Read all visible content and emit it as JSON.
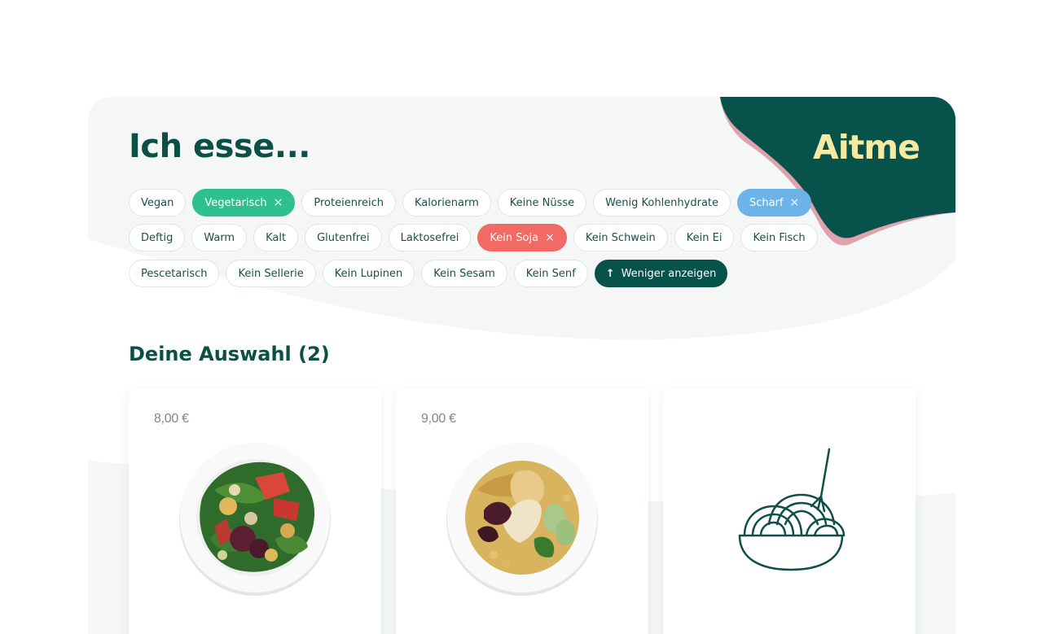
{
  "brand": {
    "logo_text": "Aitme"
  },
  "header": {
    "title": "Ich esse..."
  },
  "filters": {
    "row1": [
      {
        "label": "Vegan",
        "state": "off"
      },
      {
        "label": "Vegetarisch",
        "state": "green"
      },
      {
        "label": "Proteienreich",
        "state": "off"
      },
      {
        "label": "Kalorienarm",
        "state": "off"
      },
      {
        "label": "Keine Nüsse",
        "state": "off"
      },
      {
        "label": "Wenig Kohlenhydrate",
        "state": "off"
      },
      {
        "label": "Scharf",
        "state": "blue"
      }
    ],
    "row2": [
      {
        "label": "Deftig",
        "state": "off"
      },
      {
        "label": "Warm",
        "state": "off"
      },
      {
        "label": "Kalt",
        "state": "off"
      },
      {
        "label": "Glutenfrei",
        "state": "off"
      },
      {
        "label": "Laktosefrei",
        "state": "off"
      },
      {
        "label": "Kein Soja",
        "state": "red"
      },
      {
        "label": "Kein Schwein",
        "state": "off"
      },
      {
        "label": "Kein Ei",
        "state": "off"
      },
      {
        "label": "Kein Fisch",
        "state": "off"
      }
    ],
    "row3": [
      {
        "label": "Pescetarisch",
        "state": "off"
      },
      {
        "label": "Kein Sellerie",
        "state": "off"
      },
      {
        "label": "Kein Lupinen",
        "state": "off"
      },
      {
        "label": "Kein Sesam",
        "state": "off"
      },
      {
        "label": "Kein Senf",
        "state": "off"
      }
    ],
    "show_less_label": "Weniger anzeigen",
    "remove_glyph": "×",
    "arrow_glyph": "↑"
  },
  "selection": {
    "title": "Deine Auswahl (2)"
  },
  "cards": [
    {
      "price": "8,00 €",
      "image": "salad-bowl"
    },
    {
      "price": "9,00 €",
      "image": "chickpea-bowl"
    },
    {
      "price": "",
      "image": "noodle-bowl-icon"
    }
  ],
  "colors": {
    "brand_dark": "#07524a",
    "logo": "#f6e9a1",
    "pink_wave": "#dfa3ad",
    "vegetarian": "#2ec18c",
    "spicy": "#6cb4e8",
    "no_soy": "#f16a65"
  }
}
